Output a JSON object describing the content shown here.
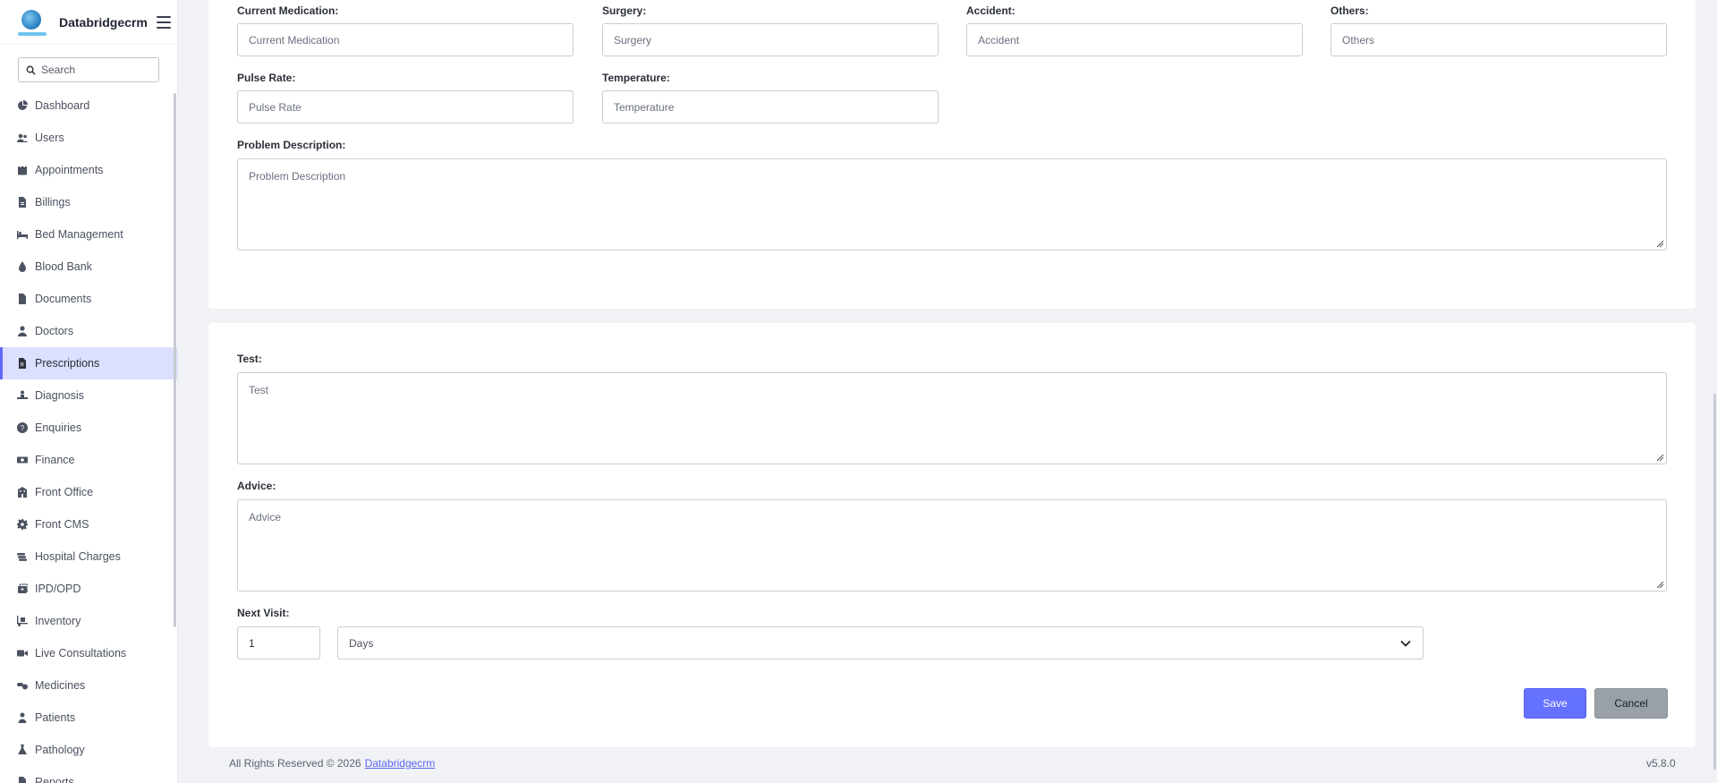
{
  "app": {
    "brand_name": "Databridgecrm"
  },
  "sidebar": {
    "search_placeholder": "Search",
    "items": [
      {
        "label": "Dashboard",
        "icon": "dashboard-icon"
      },
      {
        "label": "Users",
        "icon": "users-icon"
      },
      {
        "label": "Appointments",
        "icon": "calendar-icon"
      },
      {
        "label": "Billings",
        "icon": "file-invoice-icon"
      },
      {
        "label": "Bed Management",
        "icon": "bed-icon"
      },
      {
        "label": "Blood Bank",
        "icon": "blood-drop-icon"
      },
      {
        "label": "Documents",
        "icon": "document-icon"
      },
      {
        "label": "Doctors",
        "icon": "doctor-icon"
      },
      {
        "label": "Prescriptions",
        "icon": "prescription-icon",
        "active": true
      },
      {
        "label": "Diagnosis",
        "icon": "diagnosis-icon"
      },
      {
        "label": "Enquiries",
        "icon": "question-circle-icon"
      },
      {
        "label": "Finance",
        "icon": "money-icon"
      },
      {
        "label": "Front Office",
        "icon": "building-icon"
      },
      {
        "label": "Front CMS",
        "icon": "gear-icon"
      },
      {
        "label": "Hospital Charges",
        "icon": "coins-icon"
      },
      {
        "label": "IPD/OPD",
        "icon": "clinic-icon"
      },
      {
        "label": "Inventory",
        "icon": "dolly-icon"
      },
      {
        "label": "Live Consultations",
        "icon": "video-icon"
      },
      {
        "label": "Medicines",
        "icon": "pills-icon"
      },
      {
        "label": "Patients",
        "icon": "patient-icon"
      },
      {
        "label": "Pathology",
        "icon": "flask-icon"
      },
      {
        "label": "Reports",
        "icon": "report-icon"
      }
    ]
  },
  "form1": {
    "current_medication": {
      "label": "Current Medication:",
      "placeholder": "Current Medication"
    },
    "surgery": {
      "label": "Surgery:",
      "placeholder": "Surgery"
    },
    "accident": {
      "label": "Accident:",
      "placeholder": "Accident"
    },
    "others": {
      "label": "Others:",
      "placeholder": "Others"
    },
    "pulse_rate": {
      "label": "Pulse Rate:",
      "placeholder": "Pulse Rate"
    },
    "temperature": {
      "label": "Temperature:",
      "placeholder": "Temperature"
    },
    "problem_description": {
      "label": "Problem Description:",
      "placeholder": "Problem Description"
    }
  },
  "form2": {
    "test": {
      "label": "Test:",
      "placeholder": "Test"
    },
    "advice": {
      "label": "Advice:",
      "placeholder": "Advice"
    },
    "next_visit": {
      "label": "Next Visit:",
      "value": "1",
      "unit_selected": "Days"
    },
    "save_label": "Save",
    "cancel_label": "Cancel"
  },
  "footer": {
    "text": "All Rights Reserved © 2026",
    "link": "Databridgecrm",
    "version": "v5.8.0"
  },
  "colors": {
    "accent": "#6571ff",
    "active_bg": "#dcdffd",
    "page_bg": "#f1f2f6"
  }
}
